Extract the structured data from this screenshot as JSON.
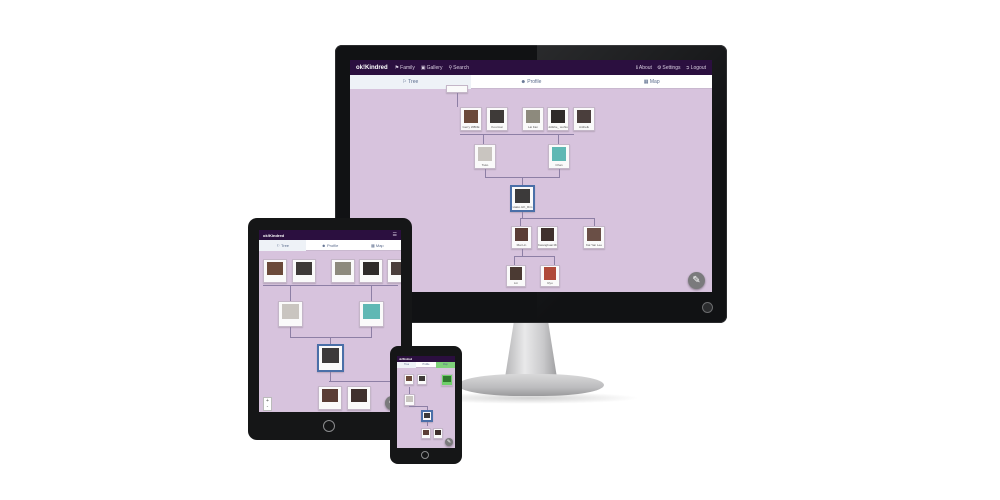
{
  "app": {
    "brand": "ok!Kindred",
    "nav": [
      {
        "label": "Family",
        "icon": "family-icon"
      },
      {
        "label": "Gallery",
        "icon": "gallery-icon"
      },
      {
        "label": "Search",
        "icon": "search-icon"
      }
    ],
    "right_nav": [
      {
        "label": "About",
        "icon": "info-icon"
      },
      {
        "label": "Settings",
        "icon": "gear-icon"
      },
      {
        "label": "Logout",
        "icon": "logout-icon"
      }
    ],
    "tabs": [
      {
        "label": "Tree",
        "icon": "tree-icon",
        "active": true
      },
      {
        "label": "Profile",
        "icon": "user-icon",
        "active": false
      },
      {
        "label": "Map",
        "icon": "map-icon",
        "active": false
      }
    ]
  },
  "tree": {
    "row1": [
      {
        "label": "Gerry W8DE"
      },
      {
        "label": "Kourmai"
      },
      {
        "label": "Lai Fan"
      },
      {
        "label": "Jolikhe_ wohtu"
      },
      {
        "label": "Anthelk"
      }
    ],
    "row2": [
      {
        "label": "Tuko"
      },
      {
        "label": "Chan"
      }
    ],
    "selected": {
      "label": "Haiko HK_Rim"
    },
    "row4": [
      {
        "label": "Mai Lin"
      },
      {
        "label": "Kwangbuai Mikhole"
      },
      {
        "label": "Kai Yan Lee"
      }
    ],
    "row5": [
      {
        "label": "Lin"
      },
      {
        "label": "Ryu"
      }
    ]
  },
  "colors": {
    "appbar": "#2b0f3f",
    "tree_background": "#d7c3dd",
    "connector": "#8d7fa5",
    "selected_border": "#4a6fa8"
  },
  "fab_icon": "pencil-icon"
}
